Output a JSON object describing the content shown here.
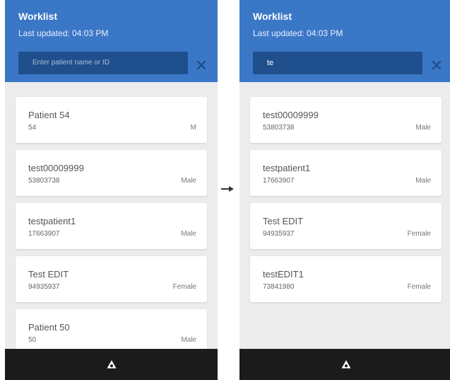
{
  "left_screen": {
    "title": "Worklist",
    "last_updated": "Last updated: 04:03 PM",
    "search_value": "",
    "search_placeholder": "Enter patient name or ID",
    "patients": [
      {
        "name": "Patient 54",
        "id": "54",
        "sex": "M"
      },
      {
        "name": "test00009999",
        "id": "53803738",
        "sex": "Male"
      },
      {
        "name": "testpatient1",
        "id": "17663907",
        "sex": "Male"
      },
      {
        "name": "Test EDIT",
        "id": "94935937",
        "sex": "Female"
      },
      {
        "name": "Patient 50",
        "id": "50",
        "sex": "Male"
      }
    ]
  },
  "right_screen": {
    "title": "Worklist",
    "last_updated": "Last updated: 04:03 PM",
    "search_value": "te",
    "patients": [
      {
        "name": "test00009999",
        "id": "53803738",
        "sex": "Male"
      },
      {
        "name": "testpatient1",
        "id": "17663907",
        "sex": "Male"
      },
      {
        "name": "Test EDIT",
        "id": "94935937",
        "sex": "Female"
      },
      {
        "name": "testEDIT1",
        "id": "73841980",
        "sex": "Female"
      }
    ]
  },
  "icons": {
    "clear": "close-icon",
    "nav": "home-triangle-icon",
    "transition": "arrow-right-icon"
  },
  "colors": {
    "header": "#3b77c7",
    "search_field": "#1f4f8c",
    "background": "#ececec",
    "navbar": "#1b1b1b"
  }
}
